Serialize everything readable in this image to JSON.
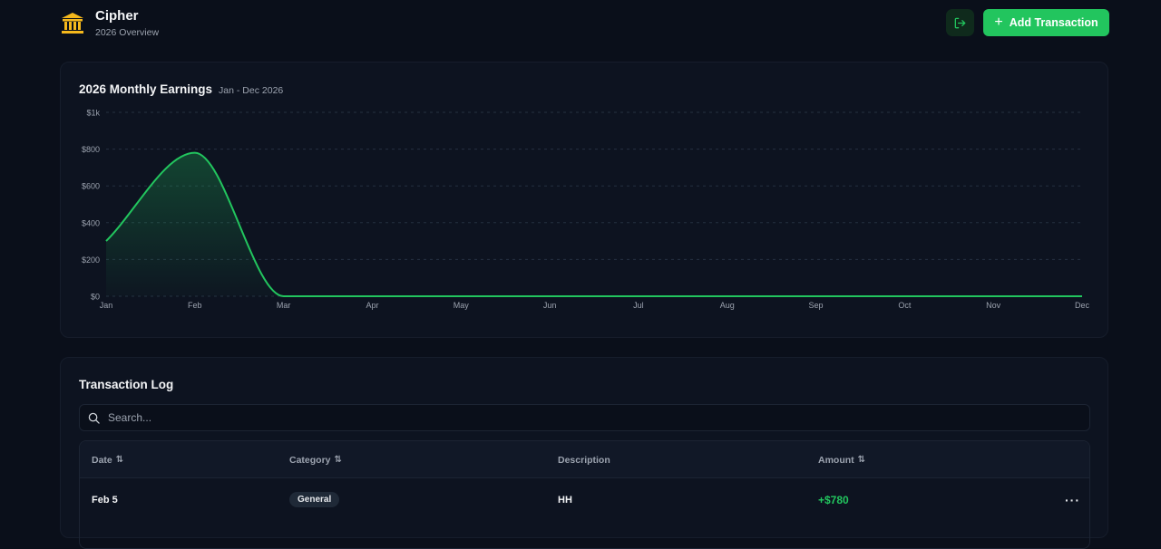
{
  "app": {
    "title": "Cipher",
    "subtitle": "2026 Overview",
    "add_label": "Add Transaction"
  },
  "colors": {
    "accent": "#22c55e",
    "background": "#0a0f1a",
    "card": "#0d1320"
  },
  "icons": {
    "brand": "bank-icon",
    "logout": "logout-icon",
    "add": "plus-icon",
    "search": "search-icon",
    "sort": "sort-icon",
    "more": "more-horizontal-icon"
  },
  "chart": {
    "title": "2026 Monthly Earnings",
    "range": "Jan - Dec 2026"
  },
  "chart_data": {
    "type": "area",
    "title": "2026 Monthly Earnings",
    "subtitle": "Jan - Dec 2026",
    "categories": [
      "Jan",
      "Feb",
      "Mar",
      "Apr",
      "May",
      "Jun",
      "Jul",
      "Aug",
      "Sep",
      "Oct",
      "Nov",
      "Dec"
    ],
    "values": [
      300,
      780,
      0,
      0,
      0,
      0,
      0,
      0,
      0,
      0,
      0,
      0
    ],
    "yticks": [
      "$0",
      "$200",
      "$400",
      "$600",
      "$800",
      "$1k"
    ],
    "ylim": [
      0,
      1000
    ],
    "grid": true,
    "color": "#22c55e"
  },
  "log": {
    "title": "Transaction Log",
    "search_placeholder": "Search...",
    "columns": [
      "Date",
      "Category",
      "Description",
      "Amount"
    ],
    "rows": [
      {
        "date": "Feb 5",
        "category": "General",
        "description": "HH",
        "amount": "+$780"
      }
    ],
    "row_menu": "···"
  }
}
